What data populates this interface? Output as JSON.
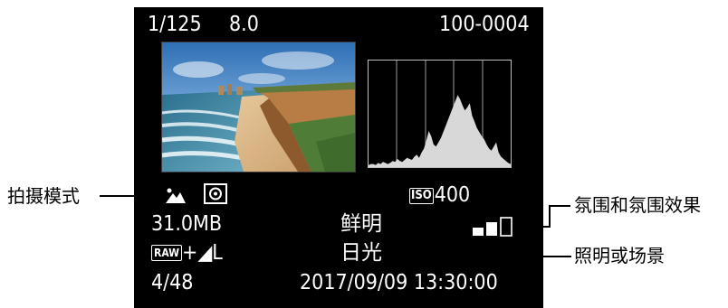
{
  "lcd": {
    "shutter": "1/125",
    "aperture": "8.0",
    "file_number": "100-0004",
    "file_size": "31.0MB",
    "picture_style": "鲜明",
    "white_balance": "日光",
    "quality_prefix": "RAW",
    "quality_suffix": "+◢L",
    "iso_label": "ISO",
    "iso_value": "400",
    "image_count": "4/48",
    "datetime": "2017/09/09 13:30:00",
    "shooting_mode_icon": "landscape-mode-icon",
    "metering_icon": "evaluative-metering-icon",
    "bracketing_icon": "bracketing-bars-icon"
  },
  "callouts": {
    "shooting_mode": "拍摄模式",
    "bracketing": "氛围和氛围效果",
    "lighting": "照明或场景"
  },
  "histogram": {
    "levels": [
      2,
      3,
      3,
      2,
      4,
      3,
      5,
      4,
      3,
      4,
      6,
      5,
      8,
      6,
      5,
      7,
      9,
      8,
      7,
      10,
      12,
      9,
      14,
      18,
      26,
      35,
      30,
      22,
      20,
      24,
      28,
      34,
      40,
      46,
      52,
      58,
      64,
      70,
      66,
      60,
      55,
      58,
      62,
      50,
      44,
      38,
      34,
      30,
      27,
      22,
      18,
      16,
      20,
      24,
      14,
      10,
      8,
      6,
      4,
      3
    ]
  },
  "colors": {
    "screen": "#000000",
    "text": "#ffffff",
    "callout_text": "#000000"
  }
}
